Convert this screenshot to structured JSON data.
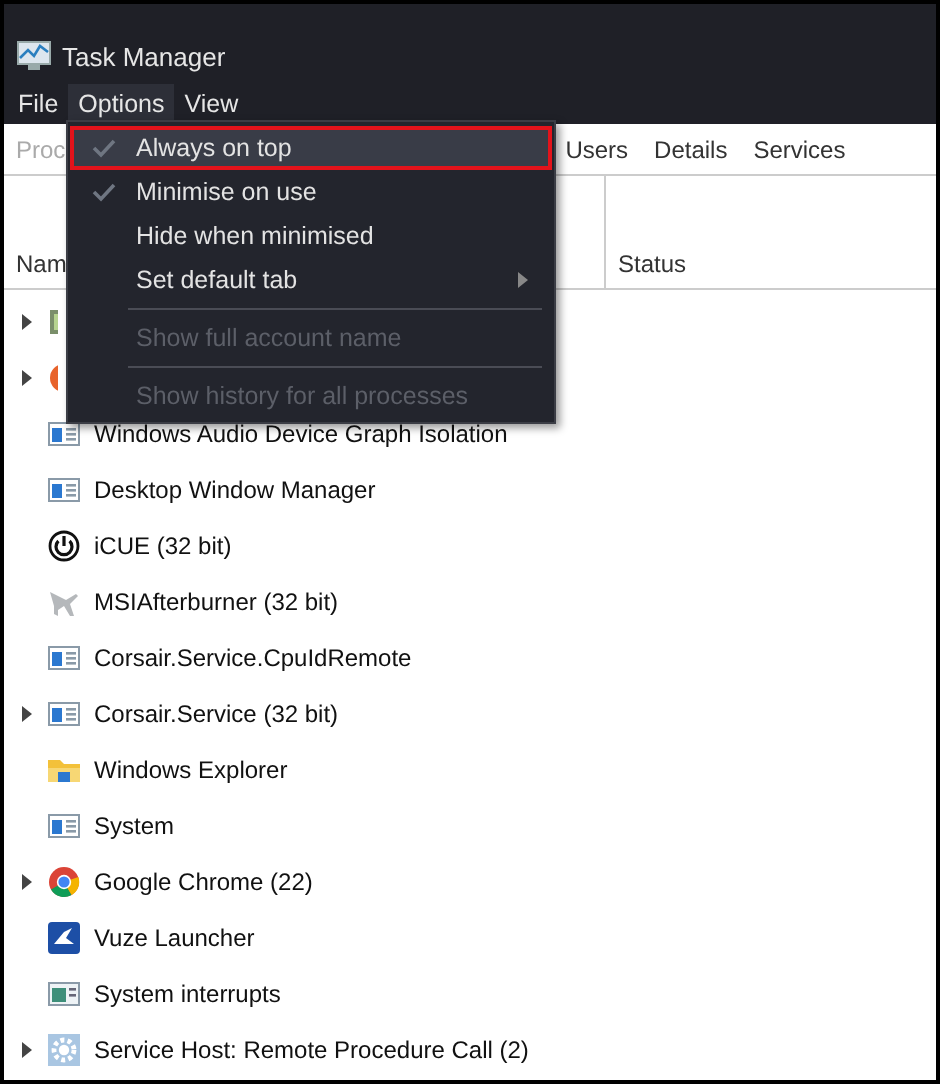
{
  "window": {
    "title": "Task Manager"
  },
  "menu_bar": [
    {
      "label": "File",
      "selected": false
    },
    {
      "label": "Options",
      "selected": true
    },
    {
      "label": "View",
      "selected": false
    }
  ],
  "tabs": [
    "Proc",
    "Users",
    "Details",
    "Services"
  ],
  "table": {
    "columns": [
      "Nam",
      "Status"
    ],
    "rows": [
      {
        "expandable": true,
        "kind": "green-app"
      },
      {
        "expandable": true,
        "kind": "orange-app"
      },
      {
        "expandable": false,
        "kind": "app-window",
        "name": "Windows Audio Device Graph Isolation"
      },
      {
        "expandable": false,
        "kind": "app-window",
        "name": "Desktop Window Manager"
      },
      {
        "expandable": false,
        "kind": "power",
        "name": "iCUE (32 bit)"
      },
      {
        "expandable": false,
        "kind": "plane",
        "name": "MSIAfterburner (32 bit)"
      },
      {
        "expandable": false,
        "kind": "app-window",
        "name": "Corsair.Service.CpuIdRemote"
      },
      {
        "expandable": true,
        "kind": "app-window",
        "name": "Corsair.Service (32 bit)"
      },
      {
        "expandable": false,
        "kind": "folder",
        "name": "Windows Explorer"
      },
      {
        "expandable": false,
        "kind": "app-window",
        "name": "System"
      },
      {
        "expandable": true,
        "kind": "chrome",
        "name": "Google Chrome (22)"
      },
      {
        "expandable": false,
        "kind": "vuze",
        "name": "Vuze Launcher"
      },
      {
        "expandable": false,
        "kind": "interrupts",
        "name": "System interrupts"
      },
      {
        "expandable": true,
        "kind": "gear",
        "name": "Service Host: Remote Procedure Call (2)"
      }
    ]
  },
  "options_menu": [
    {
      "kind": "item",
      "label": "Always on top",
      "checked": true,
      "disabled": false,
      "submenu": false,
      "highlighted": true,
      "annotated": true
    },
    {
      "kind": "item",
      "label": "Minimise on use",
      "checked": true,
      "disabled": false,
      "submenu": false,
      "highlighted": false,
      "annotated": false
    },
    {
      "kind": "item",
      "label": "Hide when minimised",
      "checked": false,
      "disabled": false,
      "submenu": false,
      "highlighted": false,
      "annotated": false
    },
    {
      "kind": "item",
      "label": "Set default tab",
      "checked": false,
      "disabled": false,
      "submenu": true,
      "highlighted": false,
      "annotated": false
    },
    {
      "kind": "separator"
    },
    {
      "kind": "item",
      "label": "Show full account name",
      "checked": false,
      "disabled": true,
      "submenu": false,
      "highlighted": false,
      "annotated": false
    },
    {
      "kind": "separator"
    },
    {
      "kind": "item",
      "label": "Show history for all processes",
      "checked": false,
      "disabled": true,
      "submenu": false,
      "highlighted": false,
      "annotated": false
    }
  ]
}
